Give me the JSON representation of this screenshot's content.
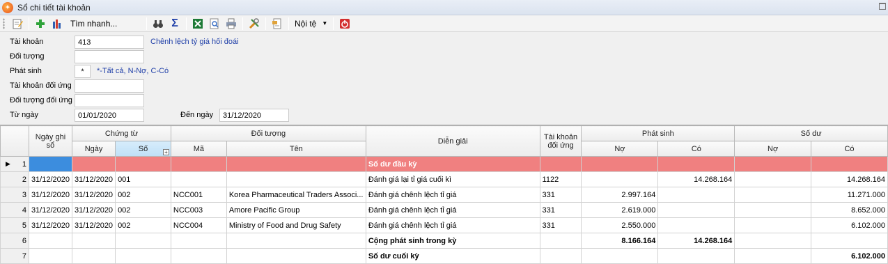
{
  "window": {
    "title": "Sổ chi tiết tài khoản",
    "app_icon": "app-logo-icon"
  },
  "toolbar": {
    "quick_search": "Tìm nhanh...",
    "currency": "Nội tệ",
    "icons": [
      "edit-icon",
      "add-icon",
      "chart-icon",
      "binoculars-icon",
      "sum-icon",
      "excel-icon",
      "preview-icon",
      "print-icon",
      "tools-icon",
      "export-icon",
      "power-icon"
    ]
  },
  "form": {
    "account_label": "Tài khoản",
    "account_value": "413",
    "account_name": "Chênh lệch tỷ giá hối đoái",
    "object_label": "Đối tượng",
    "object_value": "",
    "arising_label": "Phát sinh",
    "arising_value": "*",
    "arising_hint": "*-Tất cả, N-Nợ, C-Có",
    "contra_account_label": "Tài khoản đối ứng",
    "contra_account_value": "",
    "contra_object_label": "Đối tượng đối ứng",
    "contra_object_value": "",
    "from_date_label": "Từ ngày",
    "from_date_value": "01/01/2020",
    "to_date_label": "Đến ngày",
    "to_date_value": "31/12/2020"
  },
  "grid": {
    "headers": {
      "entry_date": "Ngày ghi sổ",
      "voucher": "Chứng từ",
      "voucher_date": "Ngày",
      "voucher_no": "Số",
      "object": "Đối tượng",
      "object_code": "Mã",
      "object_name": "Tên",
      "description": "Diễn giải",
      "contra_account": "Tài khoản đối ứng",
      "arising": "Phát sinh",
      "arising_debit": "Nợ",
      "arising_credit": "Có",
      "balance": "Số dư",
      "balance_debit": "Nợ",
      "balance_credit": "Có"
    },
    "rows": [
      {
        "n": "1",
        "entry_date": "",
        "voucher_date": "",
        "voucher_no": "",
        "object_code": "",
        "object_name": "",
        "description": "Số dư đầu kỳ",
        "contra_account": "",
        "debit": "",
        "credit": "",
        "bal_debit": "",
        "bal_credit": ""
      },
      {
        "n": "2",
        "entry_date": "31/12/2020",
        "voucher_date": "31/12/2020",
        "voucher_no": "001",
        "object_code": "",
        "object_name": "",
        "description": "Đánh giá lại tỉ giá cuối kì",
        "contra_account": "1122",
        "debit": "",
        "credit": "14.268.164",
        "bal_debit": "",
        "bal_credit": "14.268.164"
      },
      {
        "n": "3",
        "entry_date": "31/12/2020",
        "voucher_date": "31/12/2020",
        "voucher_no": "002",
        "object_code": "NCC001",
        "object_name": "Korea Pharmaceutical Traders Associ...",
        "description": "Đánh giá chênh lệch tỉ giá",
        "contra_account": "331",
        "debit": "2.997.164",
        "credit": "",
        "bal_debit": "",
        "bal_credit": "11.271.000"
      },
      {
        "n": "4",
        "entry_date": "31/12/2020",
        "voucher_date": "31/12/2020",
        "voucher_no": "002",
        "object_code": "NCC003",
        "object_name": "Amore Pacific Group",
        "description": "Đánh giá chênh lệch tỉ giá",
        "contra_account": "331",
        "debit": "2.619.000",
        "credit": "",
        "bal_debit": "",
        "bal_credit": "8.652.000"
      },
      {
        "n": "5",
        "entry_date": "31/12/2020",
        "voucher_date": "31/12/2020",
        "voucher_no": "002",
        "object_code": "NCC004",
        "object_name": "Ministry of Food and Drug Safety",
        "description": "Đánh giá chênh lệch tỉ giá",
        "contra_account": "331",
        "debit": "2.550.000",
        "credit": "",
        "bal_debit": "",
        "bal_credit": "6.102.000"
      },
      {
        "n": "6",
        "entry_date": "",
        "voucher_date": "",
        "voucher_no": "",
        "object_code": "",
        "object_name": "",
        "description": "Cộng phát sinh trong kỳ",
        "contra_account": "",
        "debit": "8.166.164",
        "credit": "14.268.164",
        "bal_debit": "",
        "bal_credit": ""
      },
      {
        "n": "7",
        "entry_date": "",
        "voucher_date": "",
        "voucher_no": "",
        "object_code": "",
        "object_name": "",
        "description": "Số dư cuối kỳ",
        "contra_account": "",
        "debit": "",
        "credit": "",
        "bal_debit": "",
        "bal_credit": "6.102.000"
      }
    ]
  }
}
